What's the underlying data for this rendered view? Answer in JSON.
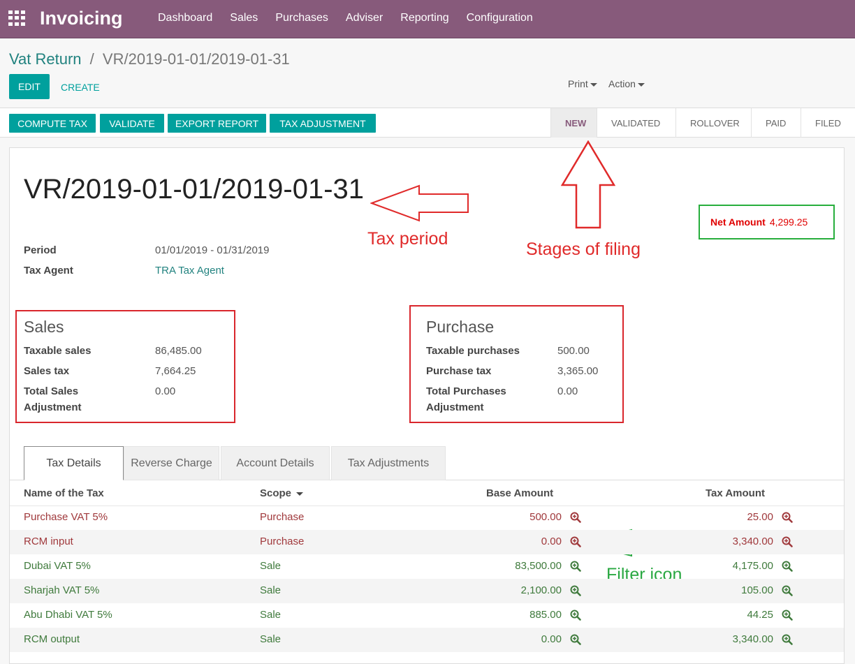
{
  "app": {
    "title": "Invoicing",
    "menu": [
      "Dashboard",
      "Sales",
      "Purchases",
      "Adviser",
      "Reporting",
      "Configuration"
    ]
  },
  "breadcrumb": {
    "parent": "Vat Return",
    "separator": "/",
    "current": "VR/2019-01-01/2019-01-31"
  },
  "controls": {
    "edit": "EDIT",
    "create": "CREATE",
    "print": "Print",
    "action": "Action"
  },
  "actions": [
    "COMPUTE TAX",
    "VALIDATE",
    "EXPORT REPORT",
    "TAX ADJUSTMENT"
  ],
  "stages": [
    "NEW",
    "VALIDATED",
    "ROLLOVER",
    "PAID",
    "FILED"
  ],
  "active_stage": "NEW",
  "record": {
    "title": "VR/2019-01-01/2019-01-31",
    "net_label": "Net Amount",
    "net_value": "4,299.25",
    "period_label": "Period",
    "period_value": "01/01/2019 - 01/31/2019",
    "agent_label": "Tax Agent",
    "agent_value": "TRA Tax Agent"
  },
  "sales": {
    "title": "Sales",
    "taxable_label": "Taxable sales",
    "taxable_value": "86,485.00",
    "tax_label": "Sales tax",
    "tax_value": "7,664.25",
    "adj_label_1": "Total Sales",
    "adj_label_2": "Adjustment",
    "adj_value": "0.00"
  },
  "purchase": {
    "title": "Purchase",
    "taxable_label": "Taxable purchases",
    "taxable_value": "500.00",
    "tax_label": "Purchase tax",
    "tax_value": "3,365.00",
    "adj_label_1": "Total Purchases",
    "adj_label_2": "Adjustment",
    "adj_value": "0.00"
  },
  "annotations": {
    "tax_period": "Tax period",
    "stages": "Stages of filing",
    "filter": "Filter icon"
  },
  "tabs": [
    "Tax Details",
    "Reverse Charge",
    "Account Details",
    "Tax Adjustments"
  ],
  "table": {
    "headers": {
      "name": "Name of the Tax",
      "scope": "Scope",
      "base": "Base Amount",
      "tax": "Tax Amount"
    },
    "rows": [
      {
        "name": "Purchase VAT 5%",
        "scope": "Purchase",
        "base": "500.00",
        "tax": "25.00"
      },
      {
        "name": "RCM input",
        "scope": "Purchase",
        "base": "0.00",
        "tax": "3,340.00"
      },
      {
        "name": "Dubai VAT 5%",
        "scope": "Sale",
        "base": "83,500.00",
        "tax": "4,175.00"
      },
      {
        "name": "Sharjah VAT 5%",
        "scope": "Sale",
        "base": "2,100.00",
        "tax": "105.00"
      },
      {
        "name": "Abu Dhabi VAT 5%",
        "scope": "Sale",
        "base": "885.00",
        "tax": "44.25"
      },
      {
        "name": "RCM output",
        "scope": "Sale",
        "base": "0.00",
        "tax": "3,340.00"
      }
    ]
  },
  "colors": {
    "purchase_row": "#a0393c",
    "sale_row": "#3f7a3c",
    "accent": "#00a09d",
    "brand": "#875a7b"
  }
}
